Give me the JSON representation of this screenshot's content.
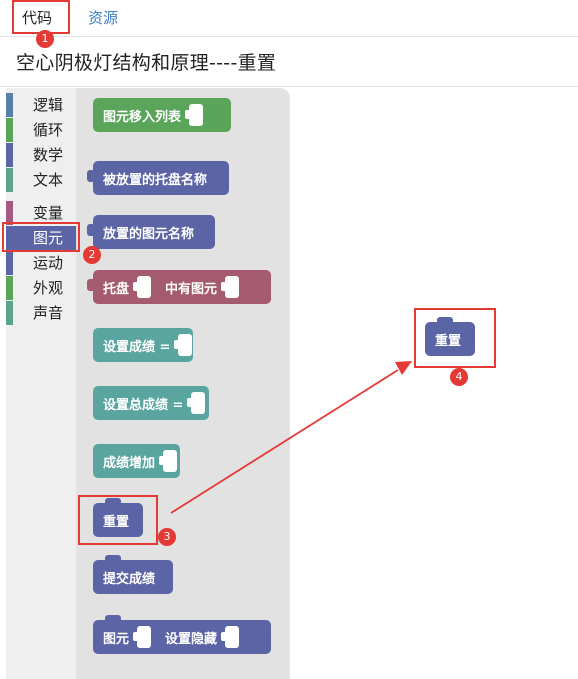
{
  "tabs": {
    "code": "代码",
    "resources": "资源"
  },
  "title": "空心阴极灯结构和原理----重置",
  "categories": [
    {
      "label": "逻辑",
      "color": "#5b80a5"
    },
    {
      "label": "循环",
      "color": "#5ba55b"
    },
    {
      "label": "数学",
      "color": "#5b67a5"
    },
    {
      "label": "文本",
      "color": "#5ba58c"
    },
    {
      "label": "变量",
      "color": "#a55b80"
    },
    {
      "label": "图元",
      "color": "#5b64a5"
    },
    {
      "label": "运动",
      "color": "#5b64a5"
    },
    {
      "label": "外观",
      "color": "#5ba55b"
    },
    {
      "label": "声音",
      "color": "#5ba58c"
    }
  ],
  "blocks": {
    "b1": "图元移入列表",
    "b2": "被放置的托盘名称",
    "b3": "放置的图元名称",
    "b4a": "托盘",
    "b4b": "中有图元",
    "b5": "设置成绩 =",
    "b6": "设置总成绩 =",
    "b7": "成绩增加",
    "b8": "重置",
    "b9": "提交成绩",
    "b10a": "图元",
    "b10b": "设置隐藏"
  },
  "workspace_block": "重置",
  "badges": [
    "1",
    "2",
    "3",
    "4"
  ],
  "colors": {
    "highlight": "#e53935",
    "arrow": "#e53935"
  }
}
